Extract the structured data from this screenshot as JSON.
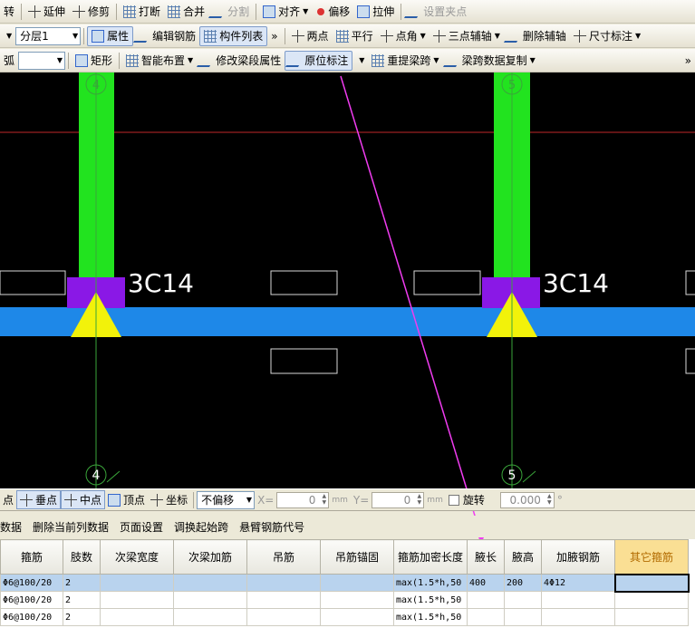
{
  "toolbar1": {
    "rotate": "转",
    "extend": "延伸",
    "trim": "修剪",
    "break": "打断",
    "merge": "合并",
    "split": "分割",
    "align": "对齐",
    "offset": "偏移",
    "stretch": "拉伸",
    "set_grip": "设置夹点"
  },
  "toolbar2": {
    "layer_select": "分层1",
    "properties": "属性",
    "edit_rebar": "编辑钢筋",
    "component_list": "构件列表",
    "more": "»",
    "two_point": "两点",
    "parallel": "平行",
    "point_angle": "点角",
    "three_point_axis": "三点辅轴",
    "delete_axis": "删除辅轴",
    "dimension": "尺寸标注"
  },
  "toolbar3": {
    "arc": "弧",
    "rect": "矩形",
    "smart_layout": "智能布置",
    "modify_span_attr": "修改梁段属性",
    "in_situ_mark": "原位标注",
    "reextract_span": "重提梁跨",
    "copy_span_data": "梁跨数据复制",
    "more": "»"
  },
  "canvas": {
    "axis_top_left": "4",
    "axis_top_right": "5",
    "axis_bottom_left": "4",
    "axis_bottom_right": "5",
    "label_left": "3C14",
    "label_right": "3C14"
  },
  "statusbar": {
    "point": "点",
    "perpendicular": "垂点",
    "midpoint": "中点",
    "vertex": "顶点",
    "coordinate": "坐标",
    "offset_mode": "不偏移",
    "x_label": "X=",
    "x_value": "0",
    "y_label": "Y=",
    "y_value": "0",
    "unit": "mm",
    "rotate": "旋转",
    "rotate_value": "0.000",
    "degree": "°"
  },
  "menubar": {
    "data": "数据",
    "delete_column_data": "删除当前列数据",
    "page_setup": "页面设置",
    "swap_start_span": "调换起始跨",
    "cantilever_code": "悬臂钢筋代号"
  },
  "grid": {
    "headers": [
      "箍筋",
      "肢数",
      "次梁宽度",
      "次梁加筋",
      "吊筋",
      "吊筋锚固",
      "箍筋加密长度",
      "腋长",
      "腋高",
      "加腋钢筋",
      "其它箍筋"
    ],
    "rows": [
      [
        "Φ6@100/20",
        "2",
        "",
        "",
        "",
        "",
        "max(1.5*h,50",
        "400",
        "200",
        "4Φ12",
        ""
      ],
      [
        "Φ6@100/20",
        "2",
        "",
        "",
        "",
        "",
        "max(1.5*h,50",
        "",
        "",
        "",
        ""
      ],
      [
        "Φ6@100/20",
        "2",
        "",
        "",
        "",
        "",
        "max(1.5*h,50",
        "",
        "",
        "",
        ""
      ]
    ]
  },
  "colors": {
    "column": "#22e31f",
    "beam": "#1e88e8",
    "cap": "#8a18e6",
    "support": "#f2f20a",
    "annotation": "#f03cf0",
    "axis": "#3aa53a"
  }
}
